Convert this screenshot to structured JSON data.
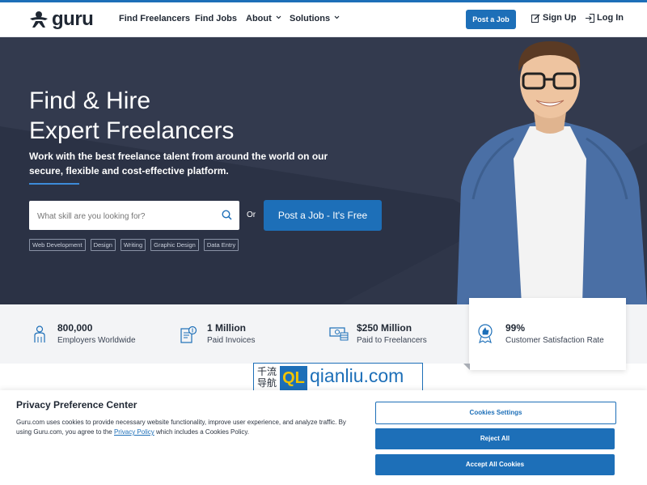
{
  "brand": {
    "logo_text": "guru",
    "accent": "#1d6fb8",
    "dark": "#2b3245"
  },
  "nav": {
    "links": [
      "Find Freelancers",
      "Find Jobs",
      "About",
      "Solutions"
    ],
    "post_job": "Post a Job",
    "sign_up": "Sign Up",
    "log_in": "Log In"
  },
  "hero": {
    "title_line1": "Find & Hire",
    "title_line2": "Expert Freelancers",
    "subtitle": "Work with the best freelance talent from around the world on our secure, flexible and cost-effective platform.",
    "search_placeholder": "What skill are you looking for?",
    "or": "Or",
    "cta": "Post a Job - It's Free",
    "tags": [
      "Web Development",
      "Design",
      "Writing",
      "Graphic Design",
      "Data Entry"
    ]
  },
  "stats": [
    {
      "num": "800,000",
      "label": "Employers Worldwide",
      "icon": "person-icon"
    },
    {
      "num": "1 Million",
      "label": "Paid Invoices",
      "icon": "invoice-icon"
    },
    {
      "num": "$250 Million",
      "label": "Paid to Freelancers",
      "icon": "money-icon"
    },
    {
      "num": "99%",
      "label": "Customer Satisfaction Rate",
      "icon": "thumbs-up-badge-icon"
    }
  ],
  "watermark": {
    "cn": "千流导航",
    "ql": "QL",
    "site": "qianliu.com"
  },
  "privacy": {
    "title": "Privacy Preference Center",
    "text_before": "Guru.com uses cookies to provide necessary website functionality, improve user experience, and analyze traffic. By using Guru.com, you agree to the ",
    "link": "Privacy Policy",
    "text_after": " which includes a Cookies Policy.",
    "settings": "Cookies Settings",
    "reject": "Reject All",
    "accept": "Accept All Cookies"
  }
}
